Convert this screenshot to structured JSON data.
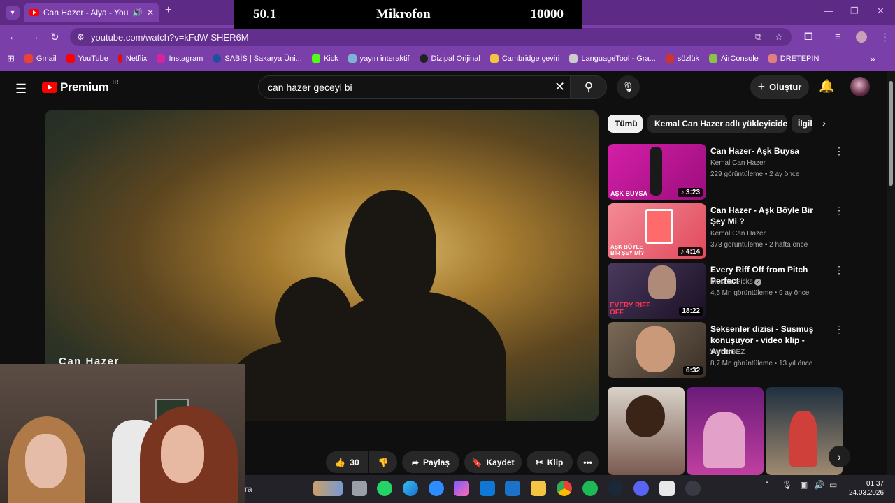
{
  "browser": {
    "tab_title": "Can Hazer - Alya - YouTube",
    "url": "youtube.com/watch?v=kFdW-SHER6M",
    "bookmarks": [
      {
        "label": "Gmail",
        "color": "#ea4335"
      },
      {
        "label": "YouTube",
        "color": "#ff0000"
      },
      {
        "label": "Netflix",
        "color": "#e50914"
      },
      {
        "label": "Instagram",
        "color": "#d6249f"
      },
      {
        "label": "SABİS | Sakarya Üni...",
        "color": "#1f4fa0"
      },
      {
        "label": "Kick",
        "color": "#53fc18"
      },
      {
        "label": "yayın interaktif",
        "color": "#7fb3d5"
      },
      {
        "label": "Dizipal Orijinal",
        "color": "#222222"
      },
      {
        "label": "Cambridge çeviri",
        "color": "#f4c542"
      },
      {
        "label": "LanguageTool - Gra...",
        "color": "#cccccc"
      },
      {
        "label": "sözlük",
        "color": "#cc3333"
      },
      {
        "label": "AirConsole",
        "color": "#8bc34a"
      },
      {
        "label": "DRETEPIN",
        "color": "#e08080"
      }
    ]
  },
  "overlay": {
    "left": "50.1",
    "center": "Mikrofon",
    "right": "10000"
  },
  "header": {
    "logo_text": "Premium",
    "region": "TR",
    "search_value": "can hazer geceyi bi",
    "create_label": "Oluştur"
  },
  "player": {
    "overlay_title": "Can Hazer"
  },
  "actions": {
    "like_count": "30",
    "share": "Paylaş",
    "save": "Kaydet",
    "clip": "Klip"
  },
  "chips": [
    "Tümü",
    "Kemal Can Hazer adlı yükleyiciden",
    "İlgili"
  ],
  "recommendations": [
    {
      "title": "Can Hazer- Aşk Buysa",
      "channel": "Kemal Can Hazer",
      "meta": "229 görüntüleme • 2 ay önce",
      "duration": "3:23",
      "thumb_text": "AŞK BUYSA",
      "color1": "#c2189d",
      "color2": "#8a0f6f"
    },
    {
      "title": "Can Hazer - Aşk Böyle Bir Şey Mi ?",
      "channel": "Kemal Can Hazer",
      "meta": "373 görüntüleme • 2 hafta önce",
      "duration": "4:14",
      "thumb_text": "AŞK BÖYLE BİR ŞEY Mİ?",
      "color1": "#f07080",
      "color2": "#d94255"
    },
    {
      "title": "Every Riff Off from Pitch Perfect",
      "channel": "Musical Picks",
      "meta": "4,5 Mn görüntüleme • 9 ay önce",
      "duration": "18:22",
      "thumb_text": "EVERY RIFF OFF",
      "color1": "#3a2a4a",
      "color2": "#1a1020"
    },
    {
      "title": "Seksenler dizisi - Susmuş konuşuyor - video klip - Aydın ...",
      "channel": "WebteGEZ",
      "meta": "8,7 Mn görüntüleme • 13 yıl önce",
      "duration": "6:32",
      "thumb_text": "",
      "color1": "#6b5a48",
      "color2": "#3a2f26"
    }
  ],
  "taskbar": {
    "search_text": "ra",
    "time": "01:37",
    "date": "24.03.2026"
  }
}
